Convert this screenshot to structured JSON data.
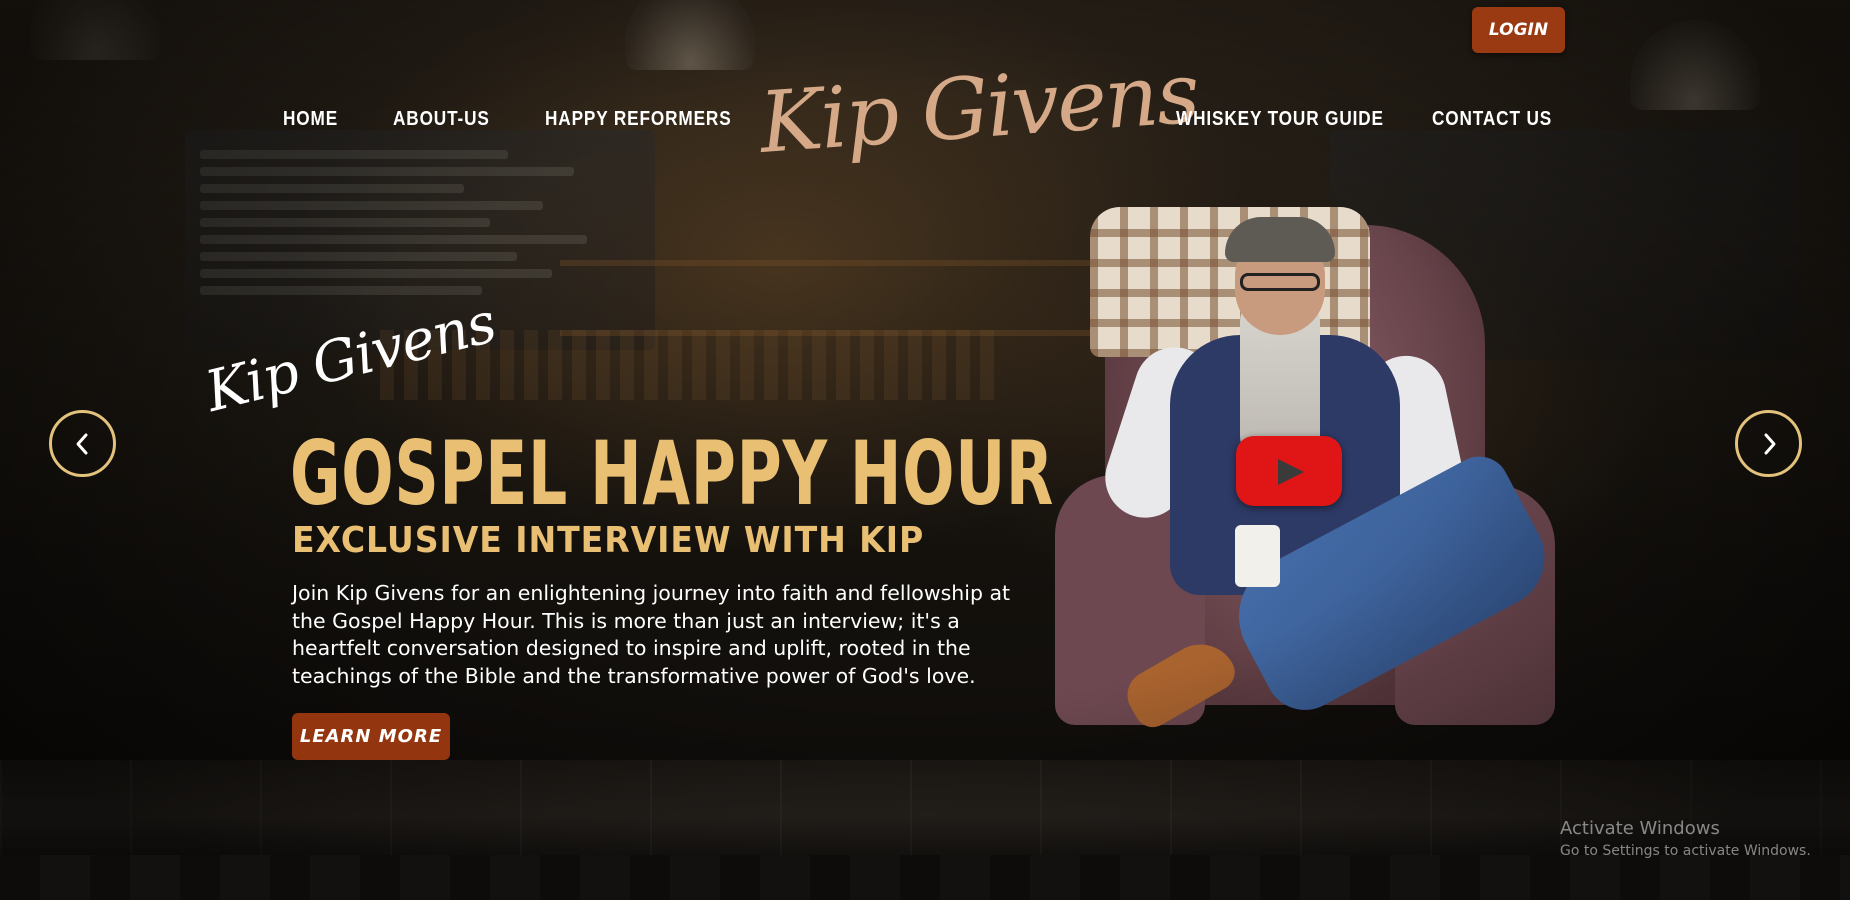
{
  "header": {
    "logo_text": "Kip Givens",
    "nav": {
      "home": "HOME",
      "about": "ABOUT-US",
      "reformers": "HAPPY REFORMERS",
      "whiskey": "WHISKEY TOUR GUIDE",
      "contact": "CONTACT US"
    },
    "login_label": "LOGIN"
  },
  "hero": {
    "script_name": "Kip Givens",
    "headline": "GOSPEL HAPPY HOUR",
    "subheadline": "EXCLUSIVE INTERVIEW WITH KIP",
    "description": "Join Kip Givens for an enlightening journey into faith and fellowship at the Gospel Happy Hour. This is more than just an interview; it's a heartfelt conversation designed to inspire and uplift, rooted in the teachings of the Bible and the transformative power of God's love.",
    "cta_label": "LEARN MORE",
    "prev_icon": "chevron-left-icon",
    "next_icon": "chevron-right-icon",
    "play_icon": "youtube-play-icon"
  },
  "system": {
    "activate_title": "Activate Windows",
    "activate_sub": "Go to Settings to activate Windows."
  },
  "colors": {
    "accent_gold": "#e9bf73",
    "button_brown": "#93360f",
    "logo_tan": "#d5a987",
    "play_red": "#e01515"
  }
}
